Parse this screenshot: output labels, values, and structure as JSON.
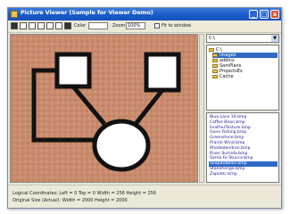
{
  "window": {
    "title": "Picture Viewer (Sample for Viewer Demo)",
    "min_glyph": "_",
    "max_glyph": "□",
    "close_glyph": "x"
  },
  "toolbar": {
    "zoom_label": "Color",
    "zoom_value": "",
    "size_label": "Zoom",
    "size_value": "100%",
    "checkbox_label": "Fit to window"
  },
  "sidebar": {
    "drive": "C:\\",
    "tree": [
      {
        "label": "C:\\",
        "selected": false
      },
      {
        "label": "Images",
        "selected": true
      },
      {
        "label": "addins",
        "selected": false
      },
      {
        "label": "SamPlans",
        "selected": false
      },
      {
        "label": "ProjectsEx",
        "selected": false
      },
      {
        "label": "Cache",
        "selected": false
      }
    ],
    "files": [
      {
        "label": "Blue Lace 16.bmp",
        "selected": false
      },
      {
        "label": "Coffee Bean.bmp",
        "selected": false
      },
      {
        "label": "FeatherTexture.bmp",
        "selected": false
      },
      {
        "label": "Gone Fishing.bmp",
        "selected": false
      },
      {
        "label": "Greenstone.bmp",
        "selected": false
      },
      {
        "label": "Prairie Wind.bmp",
        "selected": false
      },
      {
        "label": "Rhododendron.bmp",
        "selected": false
      },
      {
        "label": "River Sumida.bmp",
        "selected": false
      },
      {
        "label": "Santa Fe Stucco.bmp",
        "selected": false
      },
      {
        "label": "SoapBubbles.bmp",
        "selected": true
      },
      {
        "label": "Stonehenge.bmp",
        "selected": false
      },
      {
        "label": "Zapotec.bmp",
        "selected": false
      }
    ]
  },
  "status": {
    "line1": "Logical Coordinates:  Left = 0   Top = 0   Width = 256   Height = 256",
    "line2": "Original Size (Actual):  Width = 2000  Height = 2000"
  },
  "colors": {
    "canvas_background": "#c98b6e",
    "title_bar": "#1a5ac8",
    "selection": "#316ac5"
  }
}
